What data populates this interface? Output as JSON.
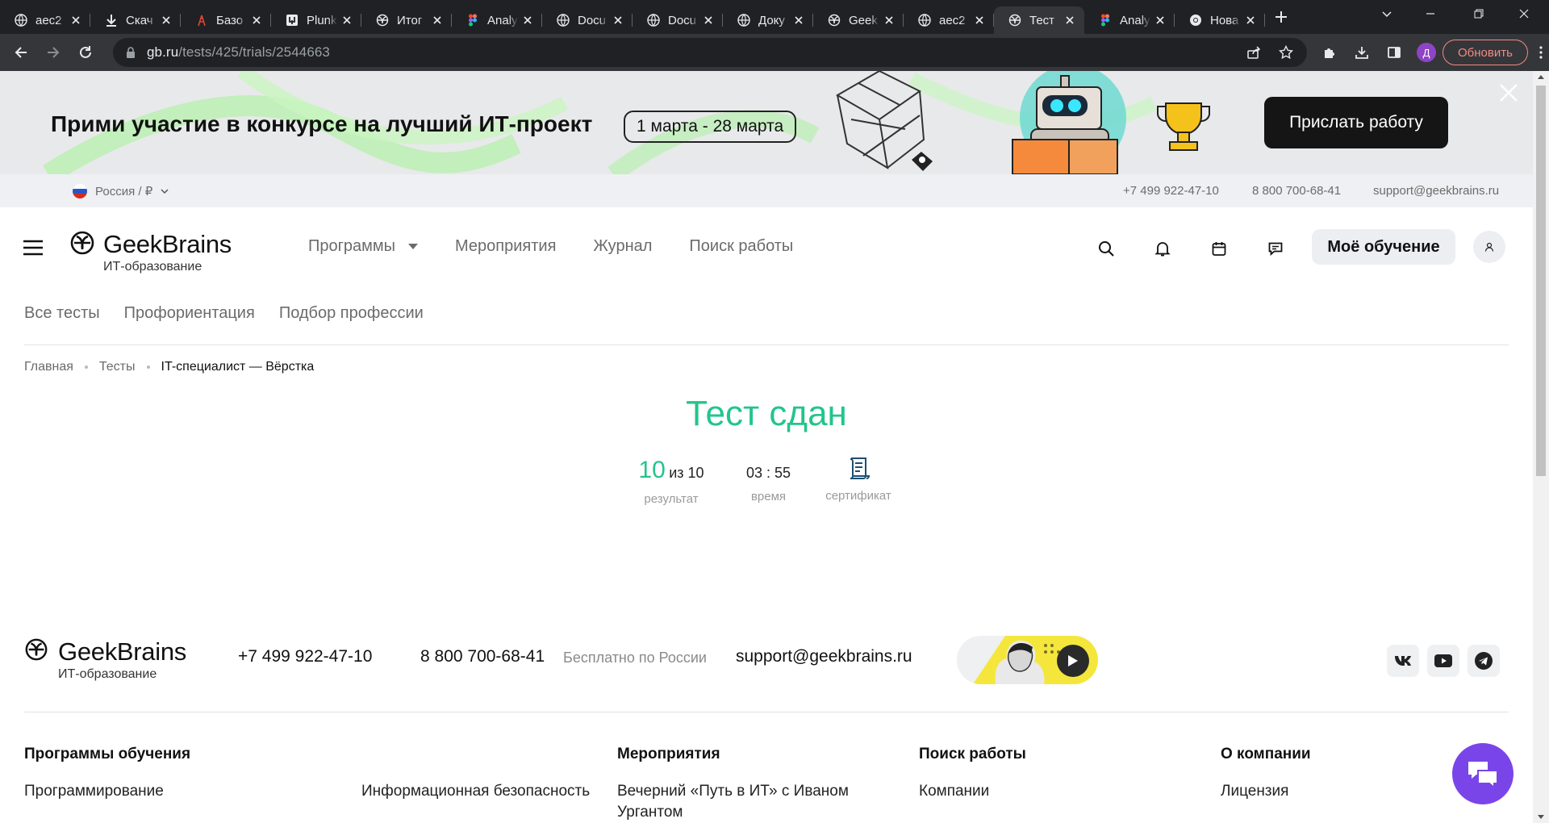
{
  "browser": {
    "tabs": [
      {
        "title": "aec2",
        "icon": "globe-icon"
      },
      {
        "title": "Скач",
        "icon": "download-icon"
      },
      {
        "title": "Базо",
        "icon": "antenna-icon"
      },
      {
        "title": "Plunk",
        "icon": "plunker-icon"
      },
      {
        "title": "Итог",
        "icon": "openai-icon"
      },
      {
        "title": "Analy",
        "icon": "figma-icon"
      },
      {
        "title": "Docu",
        "icon": "globe-icon"
      },
      {
        "title": "Docu",
        "icon": "globe-icon"
      },
      {
        "title": "Доку",
        "icon": "globe-icon"
      },
      {
        "title": "Geek",
        "icon": "openai-icon"
      },
      {
        "title": "aec2",
        "icon": "globe-icon"
      },
      {
        "title": "Тест",
        "icon": "openai-icon",
        "active": true
      },
      {
        "title": "Analy",
        "icon": "figma-icon"
      },
      {
        "title": "Нова",
        "icon": "chrome-icon"
      }
    ],
    "url_host": "gb.ru",
    "url_path": "/tests/425/trials/2544663",
    "profile_initial": "Д",
    "update_label": "Обновить"
  },
  "promo": {
    "text": "Прими участие в конкурсе на лучший ИТ-проект",
    "dates": "1 марта - 28 марта",
    "button": "Прислать работу"
  },
  "contact_strip": {
    "region": "Россия / ₽",
    "phone1": "+7 499 922-47-10",
    "phone2": "8 800 700-68-41",
    "email": "support@geekbrains.ru"
  },
  "header": {
    "logo_name": "GeekBrains",
    "logo_sub": "ИТ-образование",
    "nav": [
      "Программы",
      "Мероприятия",
      "Журнал",
      "Поиск работы"
    ],
    "my_learning": "Моё обучение"
  },
  "sub_nav": [
    "Все тесты",
    "Профориентация",
    "Подбор профессии"
  ],
  "breadcrumb": [
    "Главная",
    "Тесты",
    "IT-специалист — Вёрстка"
  ],
  "result": {
    "title": "Тест сдан",
    "score": "10",
    "score_of": "из 10",
    "score_label": "результат",
    "time": "03 : 55",
    "time_label": "время",
    "cert_label": "сертификат"
  },
  "footer": {
    "logo_name": "GeekBrains",
    "logo_sub": "ИТ-образование",
    "phone1": "+7 499 922-47-10",
    "phone2": "8 800 700-68-41",
    "free_note": "Бесплатно по России",
    "email": "support@geekbrains.ru",
    "columns": [
      {
        "title": "Программы обучения",
        "items": [
          "Программирование"
        ]
      },
      {
        "title": "",
        "items": [
          "Информационная безопасность"
        ]
      },
      {
        "title": "Мероприятия",
        "items": [
          "Вечерний «Путь в ИТ» с Иваном Ургантом"
        ]
      },
      {
        "title": "Поиск работы",
        "items": [
          "Компании"
        ]
      },
      {
        "title": "О компании",
        "items": [
          "Лицензия"
        ]
      }
    ]
  },
  "colors": {
    "accent_green": "#22c58b",
    "chat_purple": "#7a45e8",
    "chrome_dark": "#202124"
  }
}
